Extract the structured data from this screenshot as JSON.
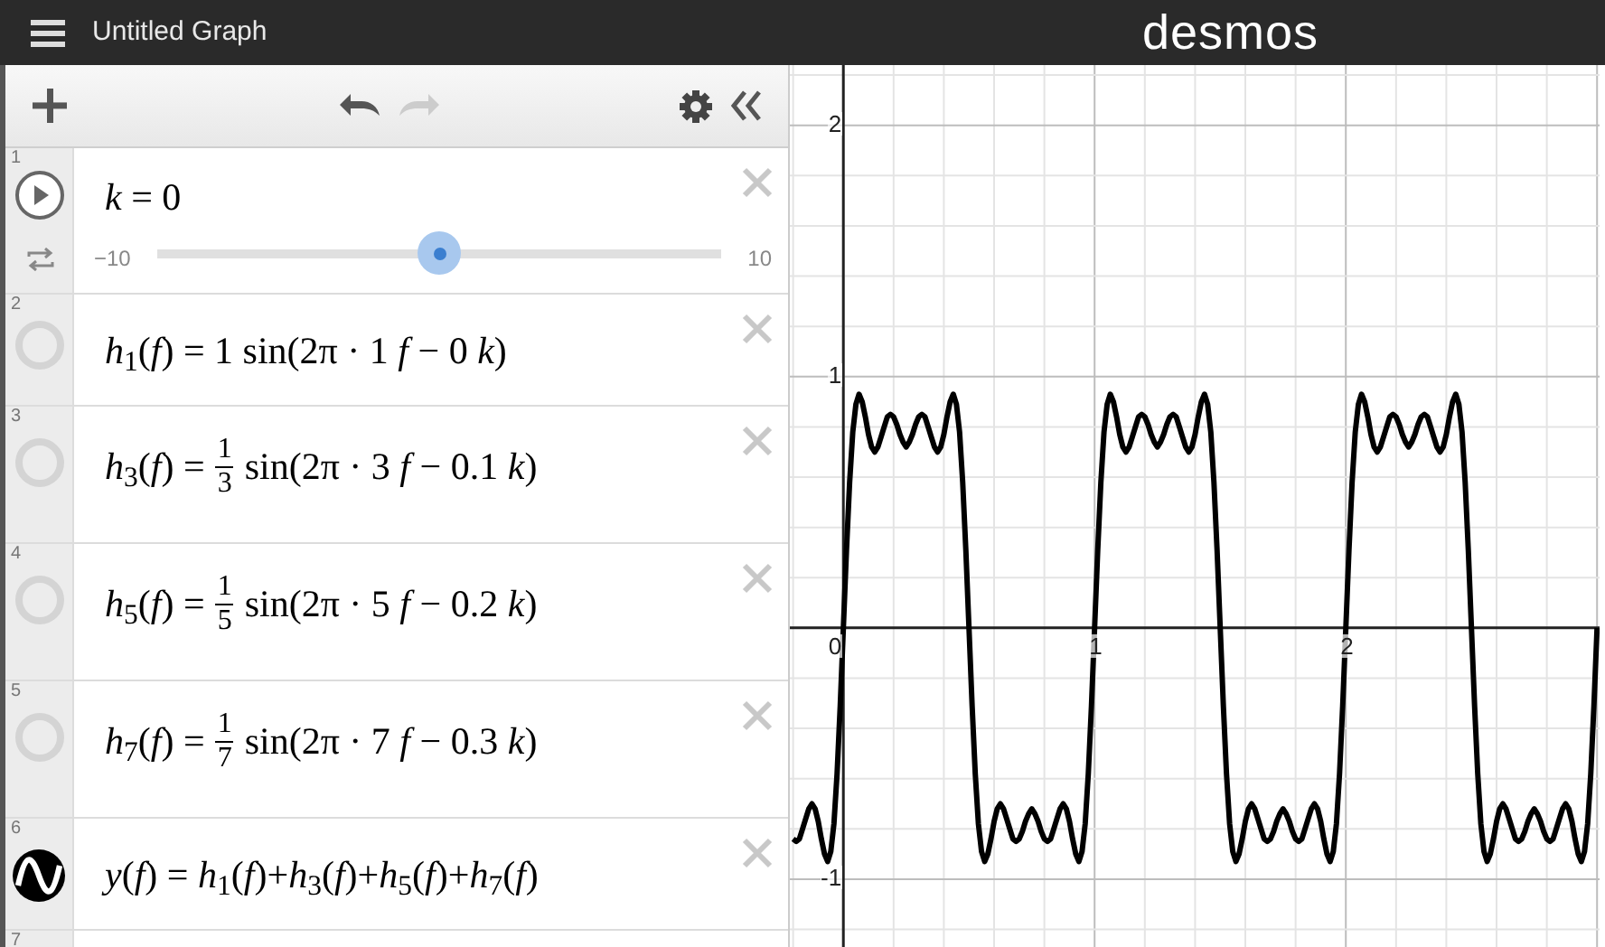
{
  "header": {
    "title": "Untitled Graph",
    "logo": "desmos"
  },
  "toolbar": {
    "undo_enabled": true,
    "redo_enabled": false
  },
  "expressions": [
    {
      "kind": "slider",
      "number": "1",
      "text": "*k* = 0",
      "min": "−10",
      "max": "10",
      "level": 0.5
    },
    {
      "kind": "function",
      "number": "2",
      "lhs": "*h*$_{1}$(*f*) = 1 sin(2π · 1 *f* − 0 *k*)",
      "visible": false
    },
    {
      "kind": "function",
      "number": "3",
      "lhs": "*h*$_{3}$(*f*) =",
      "fraction": {
        "num": "1",
        "den": "3"
      },
      "rhs": "sin(2π · 3 *f* − 0.1 *k*)",
      "visible": false
    },
    {
      "kind": "function",
      "number": "4",
      "lhs": "*h*$_{5}$(*f*) =",
      "fraction": {
        "num": "1",
        "den": "5"
      },
      "rhs": "sin(2π · 5 *f* − 0.2 *k*)",
      "visible": false
    },
    {
      "kind": "function",
      "number": "5",
      "lhs": "*h*$_{7}$(*f*) =",
      "fraction": {
        "num": "1",
        "den": "7"
      },
      "rhs": "sin(2π · 7 *f* − 0.3 *k*)",
      "visible": false
    },
    {
      "kind": "function",
      "number": "6",
      "lhs": "*y*(*f*) = *h*$_{1}$(*f*)+*h*$_{3}$(*f*)+*h*$_{5}$(*f*)+*h*$_{7}$(*f*)",
      "visible": true,
      "color": "#000000"
    },
    {
      "kind": "empty",
      "number": "7"
    }
  ],
  "graph": {
    "chart_data": {
      "type": "line",
      "xlim": [
        -0.213,
        3.01
      ],
      "ylim": [
        -1.27,
        2.24
      ],
      "grid": true,
      "xticks": [
        {
          "value": 0,
          "label": "0"
        },
        {
          "value": 1,
          "label": "1"
        },
        {
          "value": 2,
          "label": "2"
        }
      ],
      "yticks": [
        {
          "value": -1,
          "label": "-1"
        },
        {
          "value": 1,
          "label": "1"
        },
        {
          "value": 2,
          "label": "2"
        }
      ],
      "x": [
        -0.2,
        -0.1875,
        -0.175,
        -0.1625,
        -0.15,
        -0.1375,
        -0.125,
        -0.1125,
        -0.1,
        -0.0875,
        -0.075,
        -0.0625,
        -0.05,
        -0.0375,
        -0.025,
        -0.0125,
        0,
        0.0125,
        0.025,
        0.0375,
        0.05,
        0.0625,
        0.075,
        0.0875,
        0.1,
        0.1125,
        0.125,
        0.1375,
        0.15,
        0.1625,
        0.175,
        0.1875,
        0.2,
        0.2125,
        0.225,
        0.2375,
        0.25,
        0.2625,
        0.275,
        0.2875,
        0.3,
        0.3125,
        0.325,
        0.3375,
        0.35,
        0.3625,
        0.375,
        0.3875,
        0.4,
        0.4125,
        0.425,
        0.4375,
        0.45,
        0.4625,
        0.475,
        0.4875,
        0.5,
        0.5125,
        0.525,
        0.5375,
        0.55,
        0.5625,
        0.575,
        0.5875,
        0.6,
        0.6125,
        0.625,
        0.6375,
        0.65,
        0.6625,
        0.675,
        0.6875,
        0.7,
        0.7125,
        0.725,
        0.7375,
        0.75,
        0.7625,
        0.775,
        0.7875,
        0.8,
        0.8125,
        0.825,
        0.8375,
        0.85,
        0.8625,
        0.875,
        0.8875,
        0.9,
        0.9125,
        0.925,
        0.9375,
        0.95,
        0.9625,
        0.975,
        0.9875,
        1,
        1.0125,
        1.025,
        1.0375,
        1.05,
        1.0625,
        1.075,
        1.0875,
        1.1,
        1.1125,
        1.125,
        1.1375,
        1.15,
        1.1625,
        1.175,
        1.1875,
        1.2,
        1.2125,
        1.225,
        1.2375,
        1.25,
        1.2625,
        1.275,
        1.2875,
        1.3,
        1.3125,
        1.325,
        1.3375,
        1.35,
        1.3625,
        1.375,
        1.3875,
        1.4,
        1.4125,
        1.425,
        1.4375,
        1.45,
        1.4625,
        1.475,
        1.4875,
        1.5,
        1.5125,
        1.525,
        1.5375,
        1.55,
        1.5625,
        1.575,
        1.5875,
        1.6,
        1.6125,
        1.625,
        1.6375,
        1.65,
        1.6625,
        1.675,
        1.6875,
        1.7,
        1.7125,
        1.725,
        1.7375,
        1.75,
        1.7625,
        1.775,
        1.7875,
        1.8,
        1.8125,
        1.825,
        1.8375,
        1.85,
        1.8625,
        1.875,
        1.8875,
        1.9,
        1.9125,
        1.925,
        1.9375,
        1.95,
        1.9625,
        1.975,
        1.9875,
        2,
        2.0125,
        2.025,
        2.0375,
        2.05,
        2.0625,
        2.075,
        2.0875,
        2.1,
        2.1125,
        2.125,
        2.1375,
        2.15,
        2.1625,
        2.175,
        2.1875,
        2.2,
        2.2125,
        2.225,
        2.2375,
        2.25,
        2.2625,
        2.275,
        2.2875,
        2.3,
        2.3125,
        2.325,
        2.3375,
        2.35,
        2.3625,
        2.375,
        2.3875,
        2.4,
        2.4125,
        2.425,
        2.4375,
        2.45,
        2.4625,
        2.475,
        2.4875,
        2.5,
        2.5125,
        2.525,
        2.5375,
        2.55,
        2.5625,
        2.575,
        2.5875,
        2.6,
        2.6125,
        2.625,
        2.6375,
        2.65,
        2.6625,
        2.675,
        2.6875,
        2.7,
        2.7125,
        2.725,
        2.7375,
        2.75,
        2.7625,
        2.775,
        2.7875,
        2.8,
        2.8125,
        2.825,
        2.8375,
        2.85,
        2.8625,
        2.875,
        2.8875,
        2.9,
        2.9125,
        2.925,
        2.9375,
        2.95,
        2.9625,
        2.975,
        2.9875,
        3
      ],
      "series": [
        {
          "color": "#000000",
          "values": [
            -0.84,
            -0.85,
            -0.84,
            -0.8,
            -0.76,
            -0.72,
            -0.7,
            -0.72,
            -0.77,
            -0.84,
            -0.9,
            -0.93,
            -0.89,
            -0.78,
            -0.58,
            -0.31,
            0,
            0.31,
            0.58,
            0.78,
            0.89,
            0.93,
            0.9,
            0.84,
            0.77,
            0.72,
            0.7,
            0.72,
            0.76,
            0.8,
            0.84,
            0.85,
            0.84,
            0.81,
            0.77,
            0.74,
            0.72,
            0.74,
            0.77,
            0.81,
            0.84,
            0.85,
            0.84,
            0.8,
            0.76,
            0.72,
            0.7,
            0.72,
            0.77,
            0.84,
            0.9,
            0.93,
            0.89,
            0.78,
            0.58,
            0.31,
            0,
            -0.31,
            -0.58,
            -0.78,
            -0.89,
            -0.93,
            -0.9,
            -0.84,
            -0.77,
            -0.72,
            -0.7,
            -0.72,
            -0.76,
            -0.8,
            -0.84,
            -0.85,
            -0.84,
            -0.81,
            -0.77,
            -0.74,
            -0.72,
            -0.74,
            -0.77,
            -0.81,
            -0.84,
            -0.85,
            -0.84,
            -0.8,
            -0.76,
            -0.72,
            -0.7,
            -0.72,
            -0.77,
            -0.84,
            -0.9,
            -0.93,
            -0.89,
            -0.78,
            -0.58,
            -0.31,
            0,
            0.31,
            0.58,
            0.78,
            0.89,
            0.93,
            0.9,
            0.84,
            0.77,
            0.72,
            0.7,
            0.72,
            0.76,
            0.8,
            0.84,
            0.85,
            0.84,
            0.81,
            0.77,
            0.74,
            0.72,
            0.74,
            0.77,
            0.81,
            0.84,
            0.85,
            0.84,
            0.8,
            0.76,
            0.72,
            0.7,
            0.72,
            0.77,
            0.84,
            0.9,
            0.93,
            0.89,
            0.78,
            0.58,
            0.31,
            0,
            -0.31,
            -0.58,
            -0.78,
            -0.89,
            -0.93,
            -0.9,
            -0.84,
            -0.77,
            -0.72,
            -0.7,
            -0.72,
            -0.76,
            -0.8,
            -0.84,
            -0.85,
            -0.84,
            -0.81,
            -0.77,
            -0.74,
            -0.72,
            -0.74,
            -0.77,
            -0.81,
            -0.84,
            -0.85,
            -0.84,
            -0.8,
            -0.76,
            -0.72,
            -0.7,
            -0.72,
            -0.77,
            -0.84,
            -0.9,
            -0.93,
            -0.89,
            -0.78,
            -0.58,
            -0.31,
            0,
            0.31,
            0.58,
            0.78,
            0.89,
            0.93,
            0.9,
            0.84,
            0.77,
            0.72,
            0.7,
            0.72,
            0.76,
            0.8,
            0.84,
            0.85,
            0.84,
            0.81,
            0.77,
            0.74,
            0.72,
            0.74,
            0.77,
            0.81,
            0.84,
            0.85,
            0.84,
            0.8,
            0.76,
            0.72,
            0.7,
            0.72,
            0.77,
            0.84,
            0.9,
            0.93,
            0.89,
            0.78,
            0.58,
            0.31,
            0,
            -0.31,
            -0.58,
            -0.78,
            -0.89,
            -0.93,
            -0.9,
            -0.84,
            -0.77,
            -0.72,
            -0.7,
            -0.72,
            -0.76,
            -0.8,
            -0.84,
            -0.85,
            -0.84,
            -0.81,
            -0.77,
            -0.74,
            -0.72,
            -0.74,
            -0.77,
            -0.81,
            -0.84,
            -0.85,
            -0.84,
            -0.8,
            -0.76,
            -0.72,
            -0.7,
            -0.72,
            -0.77,
            -0.84,
            -0.9,
            -0.93,
            -0.89,
            -0.78,
            -0.58,
            -0.31,
            0
          ]
        }
      ]
    }
  }
}
